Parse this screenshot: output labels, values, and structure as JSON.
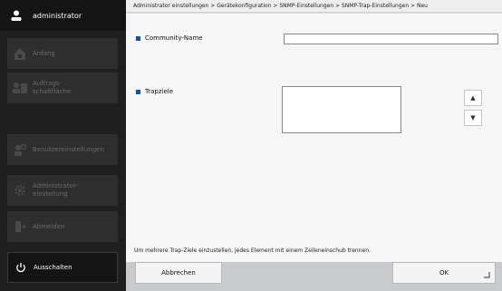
{
  "sidebar": {
    "user": "administrator",
    "items": [
      {
        "label": "Anfang",
        "icon": "home-icon"
      },
      {
        "label": "Auftrags-\nschaltfläche",
        "icon": "job-queue-icon"
      },
      {
        "label": "Benutzereinstellungen",
        "icon": "user-settings-icon"
      },
      {
        "label": "Administrator-\neinstellung",
        "icon": "gear-icon"
      },
      {
        "label": "Abmelden",
        "icon": "logout-icon"
      }
    ],
    "power_label": "Ausschalten"
  },
  "breadcrumb": "Administrator einstellungen > Gerätekonfiguration > SNMP-Einstellungen > SNMP-Trap-Einstellungen > Neu",
  "form": {
    "community_label": "Community-Name",
    "community_value": "",
    "trap_label": "Trapziele"
  },
  "hint": "Um mehrere Trap-Ziele einzustellen, jedes Element mit einem Zeileneinschub trennen.",
  "footer": {
    "cancel_label": "Abbrechen",
    "ok_label": "OK"
  },
  "colors": {
    "accent": "#1b4fa8",
    "sidebar_bg": "#1f1f1f",
    "content_bg": "#f6f6f6"
  }
}
